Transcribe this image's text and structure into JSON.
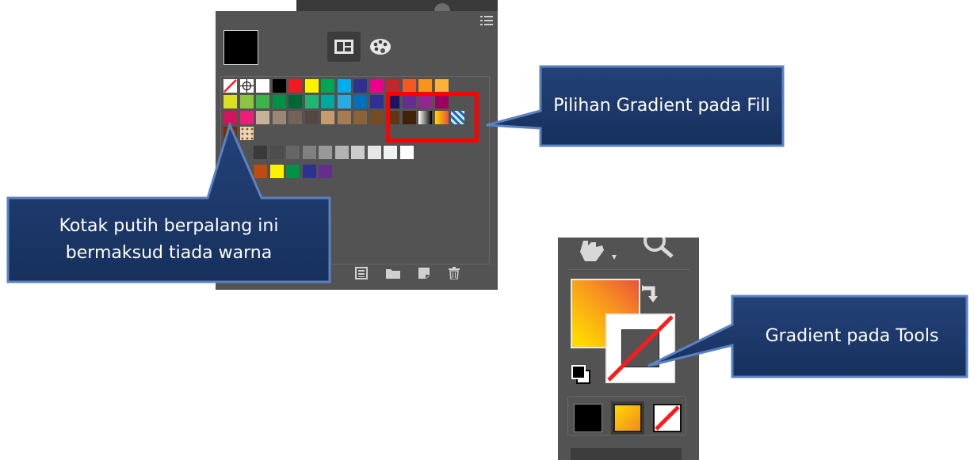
{
  "swatches_panel": {
    "fill_color": "#000000",
    "view_modes": [
      "grid-view-icon",
      "color-groups-icon"
    ],
    "bottom_icons": [
      "swatch-libraries-icon",
      "new-group-icon",
      "new-swatch-icon",
      "delete-icon"
    ],
    "gradient_highlight_color": "#ff0000"
  },
  "tools_panel": {
    "fill": "gradient",
    "stroke": "none",
    "modes": [
      "color",
      "gradient",
      "none"
    ]
  },
  "callouts": {
    "gradient_fill": "Pilihan Gradient pada Fill",
    "no_color": "Kotak putih berpalang ini bermaksud tiada warna",
    "gradient_tools": "Gradient pada Tools"
  },
  "colors": {
    "callout_fill": "#1f3868",
    "callout_border": "#3f6aa6",
    "panel_bg": "#535353"
  }
}
